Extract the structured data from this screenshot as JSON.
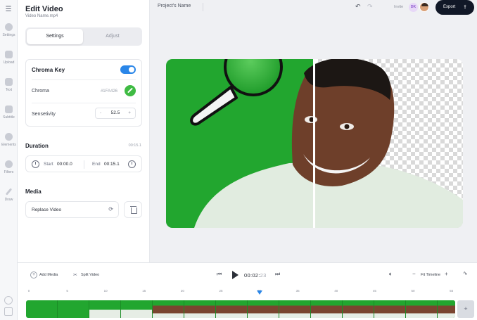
{
  "sidebar": {
    "menu_icon": "hamburger-icon",
    "items": [
      {
        "label": "Settings",
        "icon": "settings-icon"
      },
      {
        "label": "Upload",
        "icon": "upload-icon"
      },
      {
        "label": "Text",
        "icon": "text-icon"
      },
      {
        "label": "Subtitle",
        "icon": "subtitle-icon"
      },
      {
        "label": "Elements",
        "icon": "elements-icon"
      },
      {
        "label": "Filters",
        "icon": "filters-icon"
      },
      {
        "label": "Draw",
        "icon": "draw-icon"
      }
    ],
    "bottom_icons": [
      "help-icon",
      "keyboard-icon"
    ]
  },
  "panel": {
    "title": "Edit Video",
    "file_name": "Video Name.mp4",
    "tabs": [
      {
        "label": "Settings",
        "active": true
      },
      {
        "label": "Adjust",
        "active": false
      }
    ],
    "chroma_key": {
      "title": "Chroma Key",
      "enabled": true,
      "chroma_label": "Chroma",
      "chroma_value": "#1FA426",
      "sensitivity_label": "Sensetivity",
      "sensitivity_value": "52.5",
      "minus": "-",
      "plus": "+"
    },
    "duration": {
      "title": "Duration",
      "total": "00:15.1",
      "start_label": "Start",
      "start_value": "00:00.0",
      "end_label": "End",
      "end_value": "00:15.1"
    },
    "media": {
      "title": "Media",
      "replace_label": "Replace Video"
    }
  },
  "topbar": {
    "project_name": "Project's Name",
    "invite_label": "Invite",
    "avatar_initials": "DK",
    "export_label": "Export"
  },
  "timeline": {
    "add_media_label": "Add Media",
    "split_video_label": "Split Video",
    "timecode_main": "00:02:",
    "timecode_frames": "23",
    "zoom_label": "Fit Timeline",
    "ruler_ticks": [
      "0",
      "5",
      "10",
      "15",
      "20",
      "25",
      "30",
      "35",
      "40",
      "45",
      "50",
      "55"
    ],
    "playhead_seconds": 30,
    "add_track_label": "+"
  },
  "colors": {
    "accent": "#2a86e8",
    "chroma_green": "#1FA426",
    "export_bg": "#111827"
  }
}
